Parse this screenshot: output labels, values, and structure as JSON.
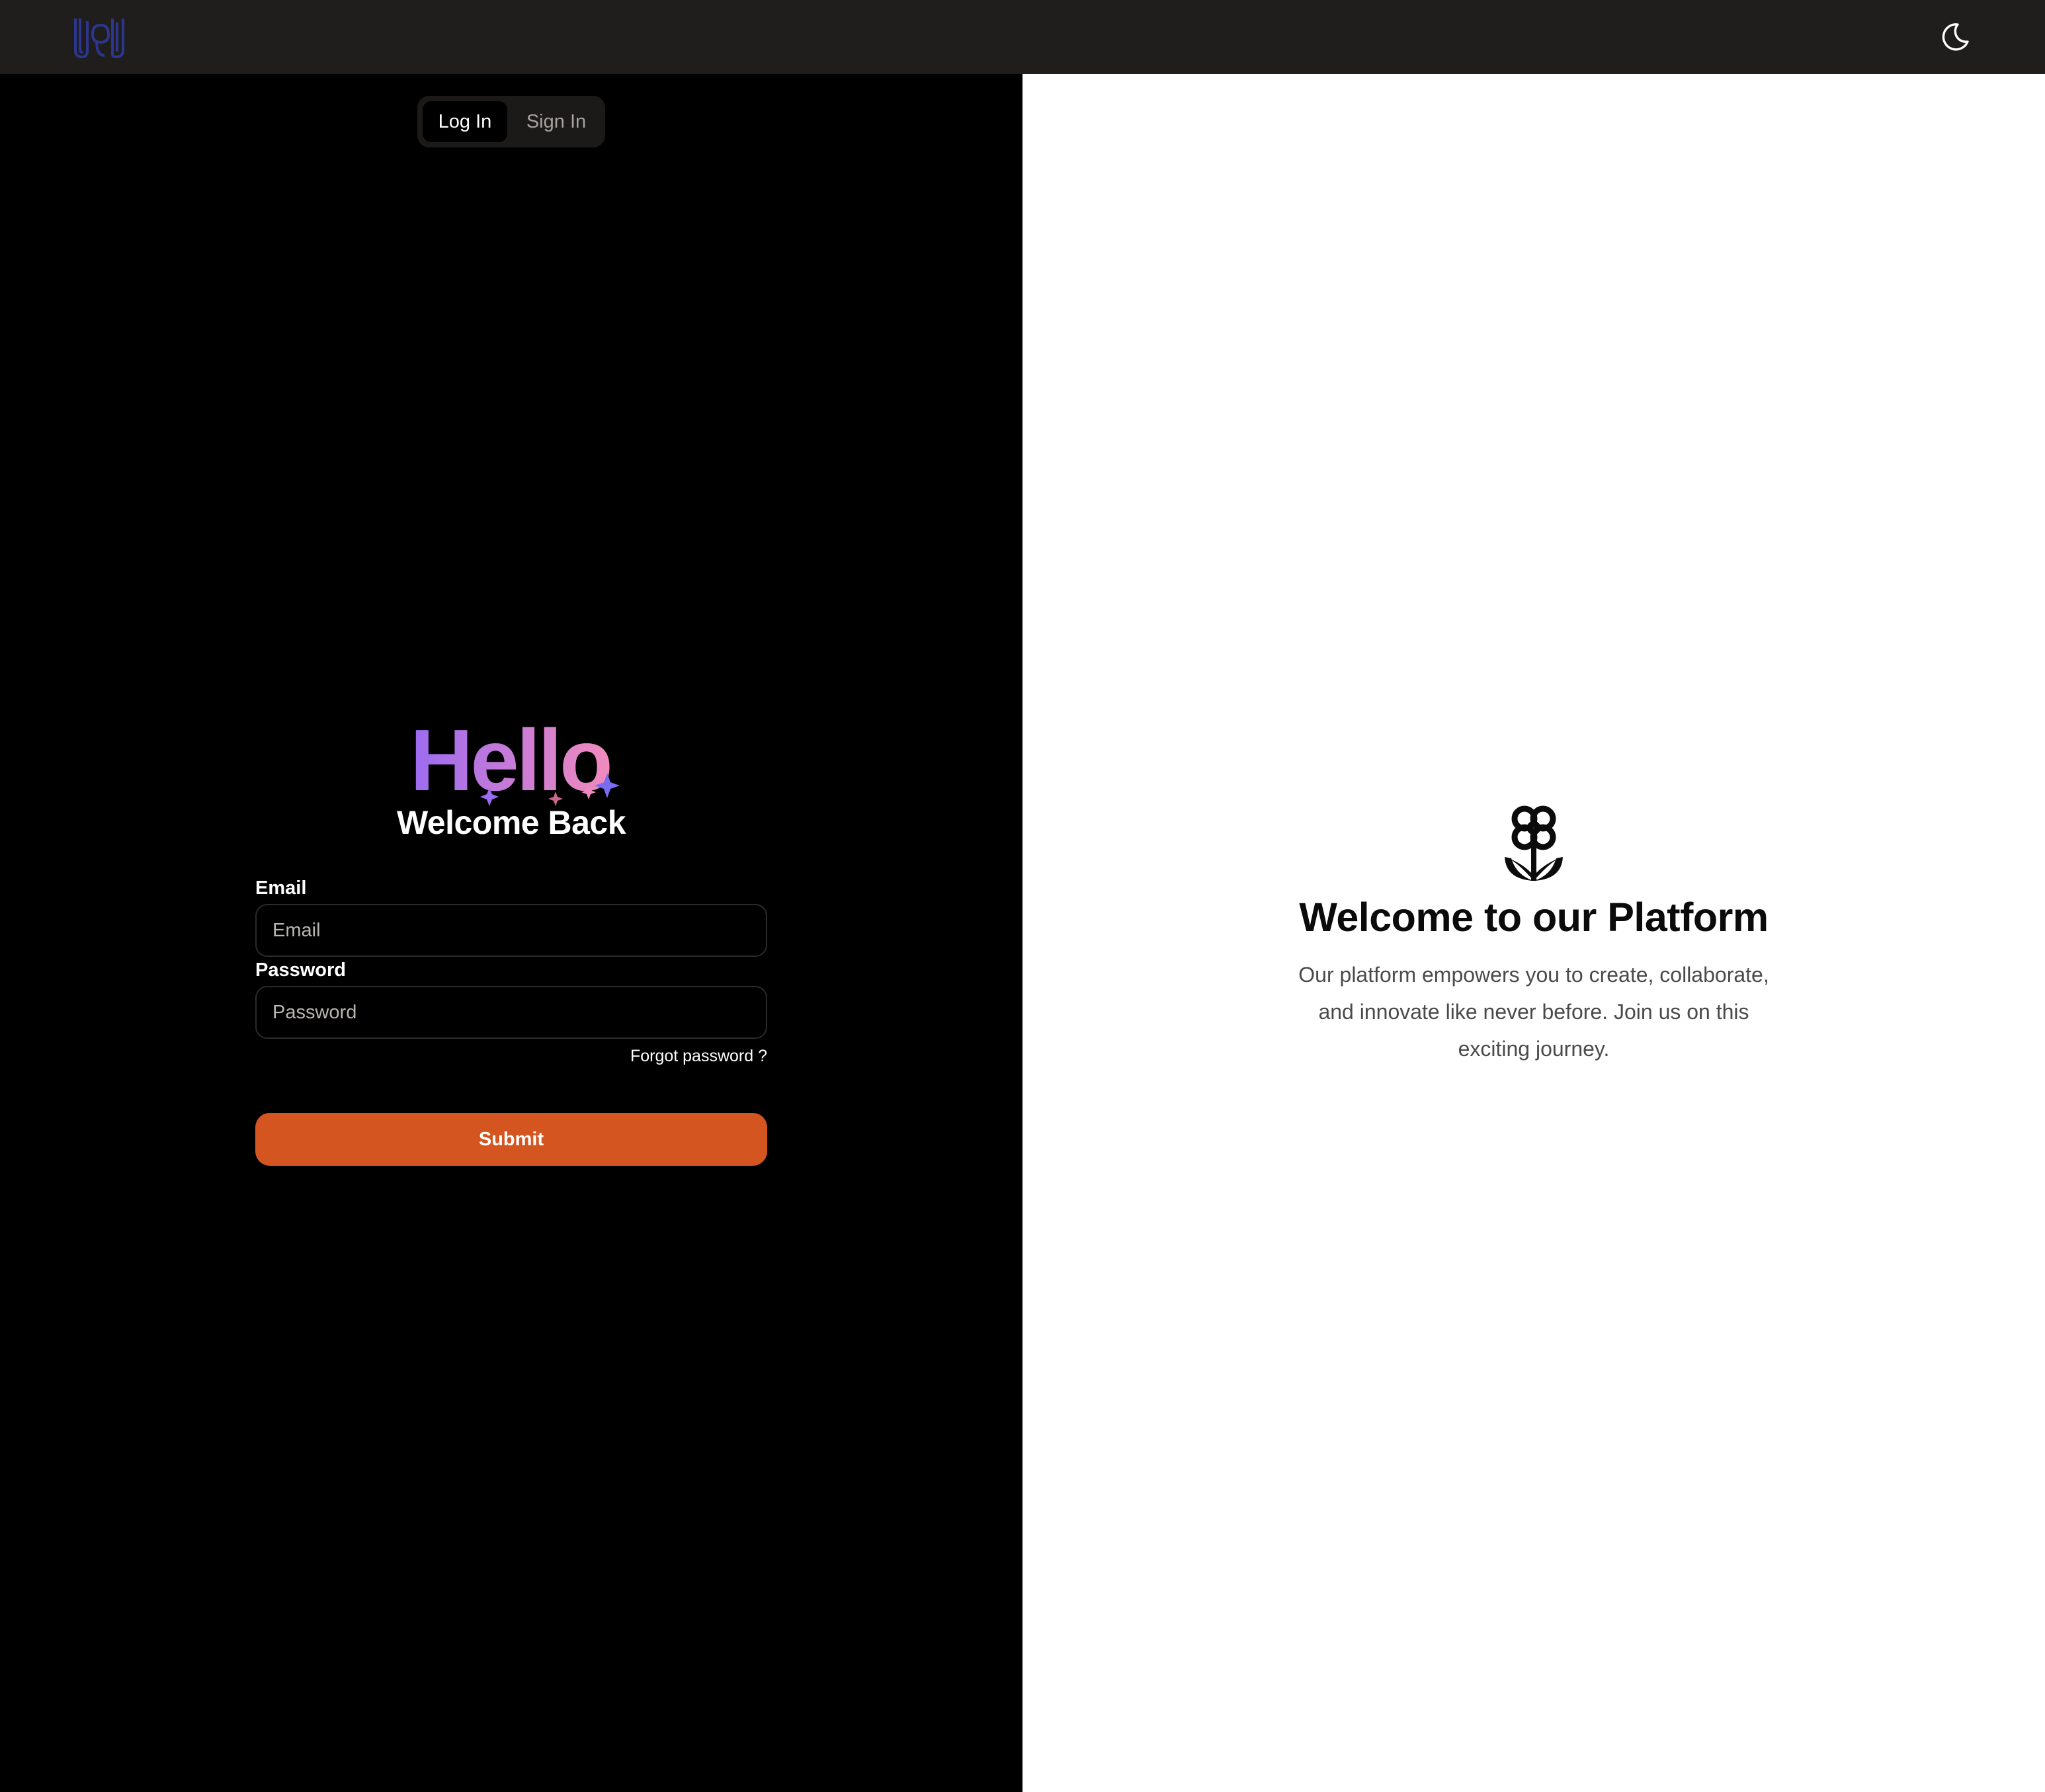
{
  "header": {
    "logo_icon": "logo-mark-icon",
    "theme_toggle_icon": "moon-icon"
  },
  "auth_tabs": [
    {
      "label": "Log In",
      "active": true
    },
    {
      "label": "Sign In",
      "active": false
    }
  ],
  "hero": {
    "hello": "Hello",
    "subtitle": "Welcome Back"
  },
  "form": {
    "email_label": "Email",
    "email_placeholder": "Email",
    "email_value": "",
    "password_label": "Password",
    "password_placeholder": "Password",
    "password_value": "",
    "forgot_link": "Forgot password ?",
    "submit_label": "Submit"
  },
  "promo": {
    "icon": "flower-icon",
    "title": "Welcome to our Platform",
    "description": "Our platform empowers you to create, collaborate, and innovate like never before. Join us on this exciting journey."
  },
  "colors": {
    "topbar": "#1f1e1d",
    "accent": "#d4551f",
    "hello_gradient_start": "#9b6bf2",
    "hello_gradient_end": "#f28bbd",
    "logo": "#2c3690"
  }
}
